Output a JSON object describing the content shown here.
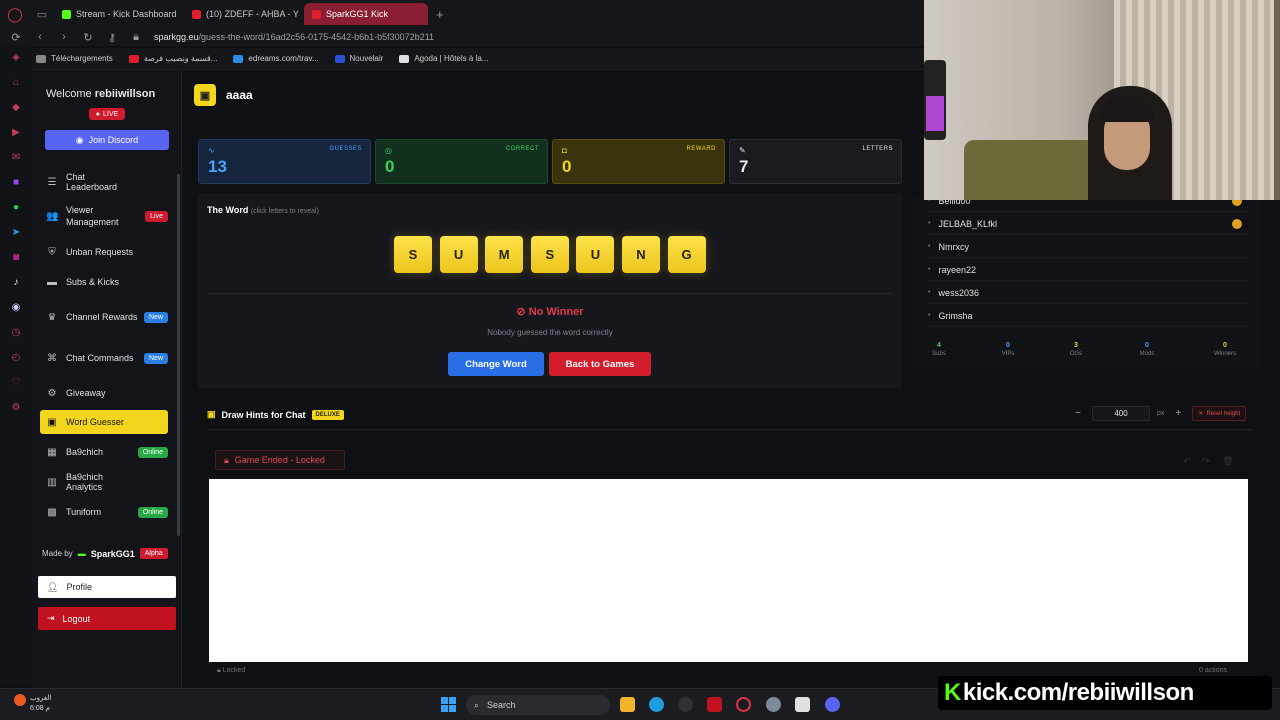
{
  "browser": {
    "tabs": [
      {
        "label": "Stream - Kick Dashboard",
        "color": "#53fc18",
        "active": false
      },
      {
        "label": "(10) ZDEFF - AHBA - Y",
        "color": "#e01d2a",
        "active": false
      },
      {
        "label": "SparkGG1 Kick",
        "color": "#e01d2a",
        "active": true
      }
    ],
    "url_host": "sparkgg.eu",
    "url_path": "/guess-the-word/16ad2c56-0175-4542-b6b1-b5f30072b211",
    "bookmarks": [
      {
        "label": "Téléchargements",
        "color": "#888888"
      },
      {
        "label": "قسمة ونصيب فرصة...",
        "color": "#e01d2a"
      },
      {
        "label": "edreams.com/trav...",
        "color": "#2a8ee6"
      },
      {
        "label": "Nouvelair",
        "color": "#2a4fd6"
      },
      {
        "label": "Agoda | Hôtels à la...",
        "color": "#e0e0e0"
      }
    ]
  },
  "sidebar": {
    "welcome_prefix": "Welcome",
    "username": "rebiiwillson",
    "live_label": "LIVE",
    "discord_label": "Join Discord",
    "items": [
      {
        "label": "Chat Leaderboard",
        "icon": "trophy-icon",
        "glyph": "☰",
        "badge": ""
      },
      {
        "label": "Viewer Management",
        "icon": "users-icon",
        "glyph": "👥",
        "badge": "Live"
      },
      {
        "label": "Unban Requests",
        "icon": "shield-icon",
        "glyph": "⛨",
        "badge": ""
      },
      {
        "label": "Subs & Kicks",
        "icon": "kick-icon",
        "glyph": "▬",
        "badge": ""
      },
      {
        "label": "Channel Rewards",
        "icon": "reward-icon",
        "glyph": "♛",
        "badge": "New"
      },
      {
        "label": "Chat Commands",
        "icon": "command-icon",
        "glyph": "⌘",
        "badge": "New"
      },
      {
        "label": "Giveaway",
        "icon": "gift-icon",
        "glyph": "⚙",
        "badge": ""
      },
      {
        "label": "Word Guesser",
        "icon": "gamepad-icon",
        "glyph": "▣",
        "badge": ""
      },
      {
        "label": "Ba9chich",
        "icon": "ba9chich-icon",
        "glyph": "▦",
        "badge": "Online"
      },
      {
        "label": "Ba9chich Analytics",
        "icon": "analytics-icon",
        "glyph": "▥",
        "badge": ""
      },
      {
        "label": "Tuniform",
        "icon": "tuniform-icon",
        "glyph": "▩",
        "badge": "Online"
      }
    ],
    "made_by_prefix": "Made by",
    "made_by_name": "SparkGG1",
    "alpha_label": "Alpha",
    "profile_label": "Profile",
    "logout_label": "Logout"
  },
  "game": {
    "title": "aaaa",
    "stats": [
      {
        "label": "GUESSES",
        "value": "13",
        "bg": "#14253d",
        "border": "#1f3a5e",
        "fg": "#4aa3ff",
        "icon_glyph": "∿"
      },
      {
        "label": "CORRECT",
        "value": "0",
        "bg": "#12301e",
        "border": "#1c4a2c",
        "fg": "#3ed064",
        "icon_glyph": "◎"
      },
      {
        "label": "REWARD",
        "value": "0",
        "bg": "#3a330c",
        "border": "#5a4c0f",
        "fg": "#f2d61e",
        "icon_glyph": "◘"
      },
      {
        "label": "LETTERS",
        "value": "7",
        "bg": "#1a1b20",
        "border": "#2a2c33",
        "fg": "#e8e8e8",
        "icon_glyph": "✎"
      }
    ],
    "word_heading": "The Word",
    "word_hint": "(click letters to reveal)",
    "letters": [
      "S",
      "U",
      "M",
      "S",
      "U",
      "N",
      "G"
    ],
    "result_title": "No Winner",
    "result_subtitle": "Nobody guessed the word correctly",
    "change_word_label": "Change Word",
    "back_label": "Back to Games"
  },
  "draw": {
    "title": "Draw Hints for Chat",
    "deluxe_label": "DELUXE",
    "height_value": "400",
    "px_label": "px",
    "reset_label": "Reset height",
    "ended_label": "Game Ended - Locked",
    "locked_footer": "Locked",
    "actions_footer": "0 actions"
  },
  "chat_users": {
    "users": [
      "Bellid00",
      "JELBAB_KLfkl",
      "Nmrxcy",
      "rayeen22",
      "wess2036",
      "Grimsha"
    ],
    "summary": [
      {
        "value": "4",
        "label": "Subs",
        "color": "#3ed064"
      },
      {
        "value": "0",
        "label": "VIPs",
        "color": "#4aa3ff"
      },
      {
        "value": "3",
        "label": "OGs",
        "color": "#f2d61e"
      },
      {
        "value": "0",
        "label": "Mods",
        "color": "#4aa3ff"
      },
      {
        "value": "0",
        "label": "Winners",
        "color": "#f2d61e"
      }
    ]
  },
  "taskbar": {
    "weather_label": "الغروب",
    "weather_time": "6:08 م",
    "search_label": "Search"
  },
  "overlay": {
    "kick_url": "kick.com/rebiiwillson"
  }
}
